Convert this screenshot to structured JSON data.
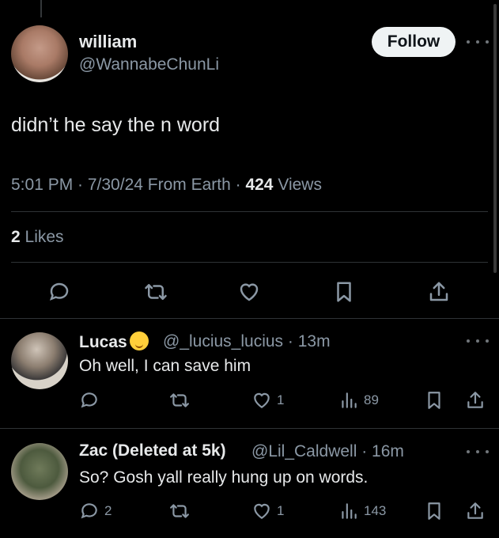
{
  "main_tweet": {
    "display_name": "william",
    "handle": "@WannabeChunLi",
    "follow_label": "Follow",
    "text": "didn’t he say the n word",
    "time": "5:01 PM · 7/30/24 From Earth · ",
    "views_count": "424",
    "views_label": " Views",
    "likes_count": "2",
    "likes_label": " Likes"
  },
  "replies": [
    {
      "display_name": "Lucas",
      "handle_time": "@_lucius_lucius · 13m",
      "text": "Oh well, I can save him",
      "likes": "1",
      "views": "89"
    },
    {
      "display_name": "Zac (Deleted at 5k)",
      "handle_time": "@Lil_Caldwell · 16m",
      "text": "So? Gosh yall really hung up on words.",
      "replies": "2",
      "likes": "1",
      "views": "143"
    }
  ],
  "icons": [
    "reply-icon",
    "retweet-icon",
    "like-icon",
    "bookmark-icon",
    "share-icon",
    "views-icon",
    "more-icon"
  ],
  "colors": {
    "background": "#000000",
    "text": "#e7e9ea",
    "muted": "#71767b",
    "follow_bg": "#eff3f4"
  }
}
